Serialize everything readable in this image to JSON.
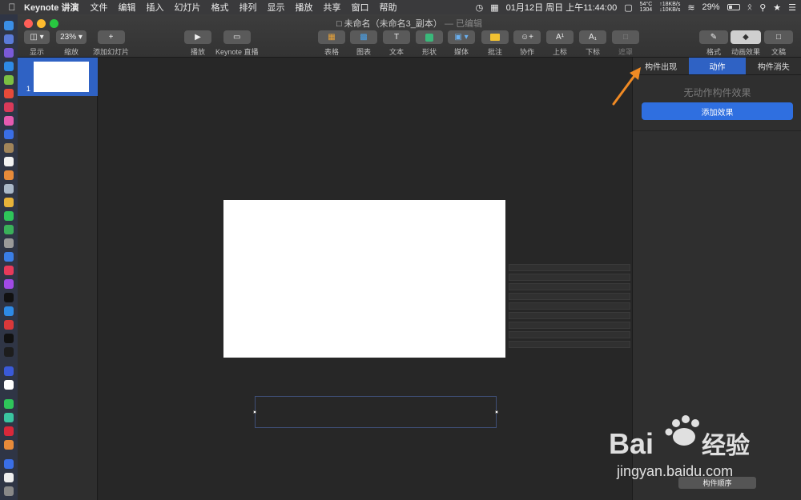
{
  "menubar": {
    "app_name": "Keynote 讲演",
    "menus": [
      "文件",
      "编辑",
      "插入",
      "幻灯片",
      "格式",
      "排列",
      "显示",
      "播放",
      "共享",
      "窗口",
      "帮助"
    ],
    "clock": "01月12日 周日 上午11:44:00",
    "temp": "54°C",
    "rpm": "1304",
    "net_up": "↑18KB/s",
    "net_down": "↓10KB/s",
    "battery": "29%"
  },
  "window": {
    "doc_title": "未命名（未命名3_副本）",
    "edited": "— 已编辑"
  },
  "toolbar": {
    "view_label": "显示",
    "zoom_value": "23%",
    "zoom_label": "缩放",
    "add_slide_label": "添加幻灯片",
    "play_label": "播放",
    "keynote_live_label": "Keynote 直播",
    "table_label": "表格",
    "chart_label": "图表",
    "text_label": "文本",
    "shape_label": "形状",
    "media_label": "媒体",
    "comment_label": "批注",
    "collaborate_label": "协作",
    "superscript_label": "上标",
    "subscript_label": "下标",
    "mask_label": "遮罩",
    "format_label": "格式",
    "animate_label": "动画效果",
    "document_label": "文稿"
  },
  "navigator": {
    "slide_number": "1"
  },
  "inspector": {
    "tabs": [
      "构件出现",
      "动作",
      "构件消失"
    ],
    "active_tab_index": 1,
    "no_effect": "无动作构件效果",
    "add_effect": "添加效果",
    "build_order": "构件顺序"
  },
  "watermark": {
    "brand": "Bai",
    "brand2": "经验",
    "url": "jingyan.baidu.com"
  },
  "colors": {
    "accent": "#2f62c4",
    "button_blue": "#2f6fe0",
    "arrow": "#f08a24"
  }
}
